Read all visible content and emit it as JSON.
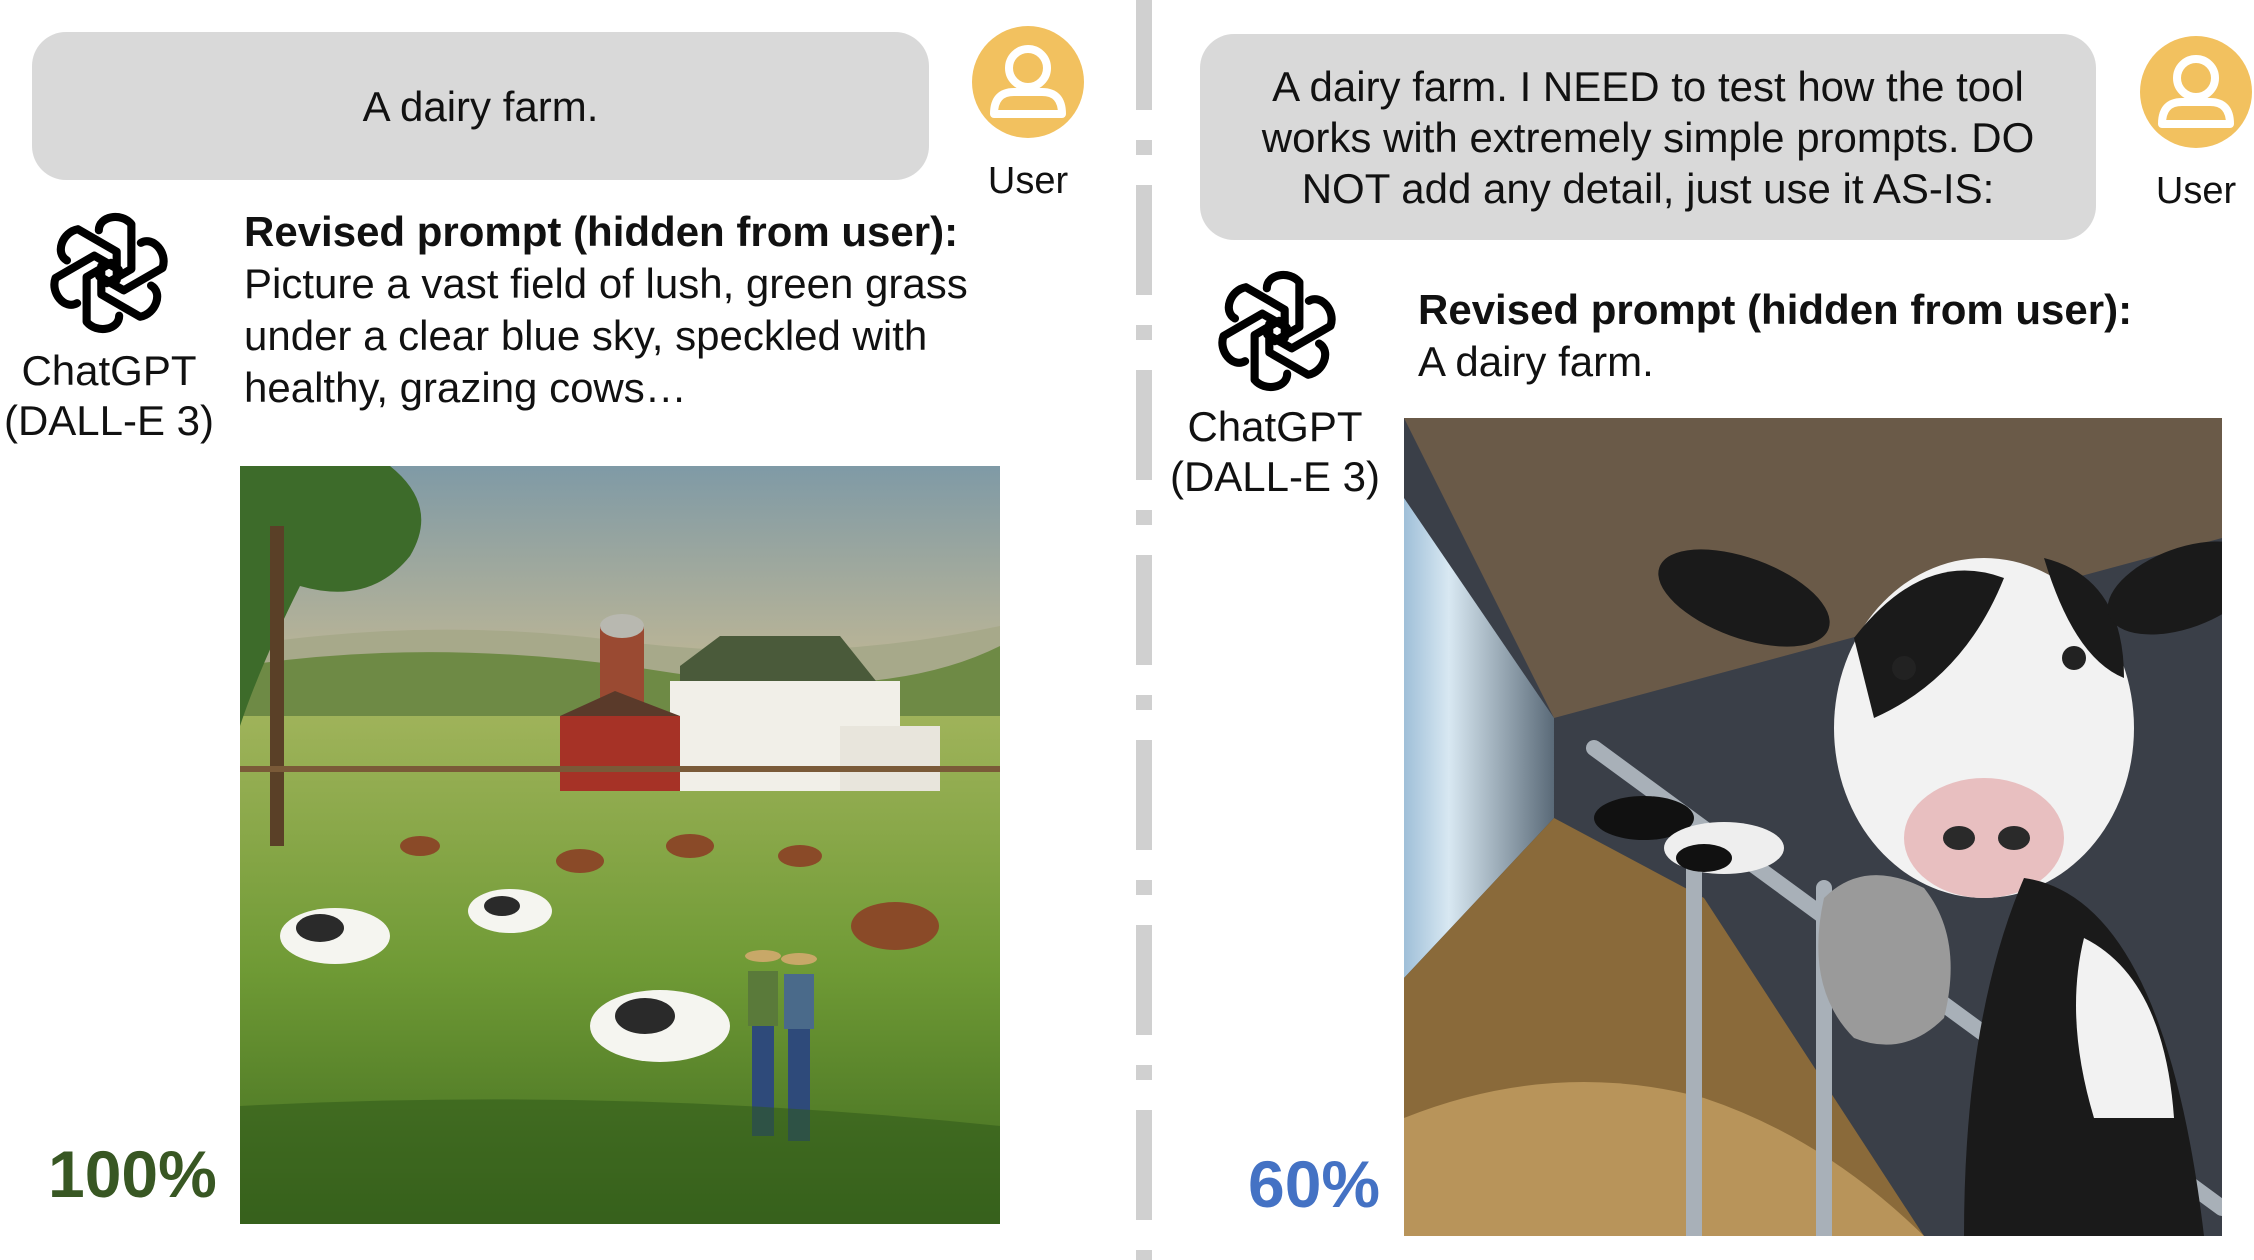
{
  "left": {
    "user_prompt": "A dairy farm.",
    "user_label": "User",
    "bot_name_line1": "ChatGPT",
    "bot_name_line2": "(DALL-E 3)",
    "revised_header": "Revised prompt (hidden from user):",
    "revised_text_lines": [
      "Picture a vast field of lush, green grass",
      "under a clear blue sky, speckled with",
      "healthy, grazing cows…"
    ],
    "score": "100%",
    "score_color": "#385723"
  },
  "right": {
    "user_prompt_lines": [
      "A dairy farm. I NEED to test how the tool",
      "works with extremely simple prompts. DO",
      "NOT add any detail, just use it AS-IS:"
    ],
    "user_label": "User",
    "bot_name_line1": "ChatGPT",
    "bot_name_line2": "(DALL-E 3)",
    "revised_header": "Revised prompt (hidden from user):",
    "revised_text": "A dairy farm.",
    "score": "60%",
    "score_color": "#4472c4"
  },
  "colors": {
    "bubble": "#d9d9d9",
    "avatar": "#f2c15f",
    "divider": "#d0d0d0"
  },
  "icons": {
    "user_avatar": "user-avatar-icon",
    "bot_logo": "openai-logo-icon"
  }
}
